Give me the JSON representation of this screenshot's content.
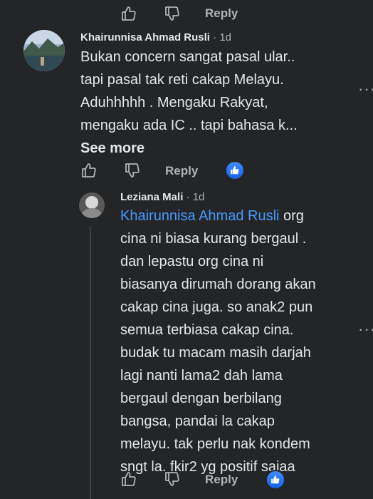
{
  "top_actions": {
    "reply_label": "Reply"
  },
  "comment1": {
    "author": "Khairunnisa Ahmad Rusli",
    "time": "1d",
    "lines": [
      "Bukan concern sangat pasal ular..",
      "tapi pasal tak reti cakap Melayu.",
      "Aduhhhhh . Mengaku Rakyat,",
      "mengaku ada IC .. tapi bahasa k..."
    ],
    "see_more": "See more",
    "reply_label": "Reply",
    "reaction_icon": "like-reaction-icon"
  },
  "reply1": {
    "author": "Leziana Mali",
    "time": "1d",
    "mention": "Khairunnisa Ahmad Rusli",
    "first_line_rest": " org",
    "lines": [
      "cina ni biasa kurang bergaul .",
      "dan lepastu org cina ni",
      "biasanya dirumah dorang akan",
      "cakap cina juga. so anak2 pun",
      "semua terbiasa cakap cina.",
      "budak tu macam masih darjah",
      "lagi nanti lama2 dah lama",
      "bergaul dengan berbilang",
      "bangsa, pandai la cakap",
      "melayu. tak perlu nak kondem",
      "sngt la. fkir2 yg positif sajaa"
    ],
    "reply_label": "Reply",
    "reaction_icon": "like-reaction-icon"
  },
  "colors": {
    "background": "#242526",
    "text": "#e4e6eb",
    "secondary": "#b0b3b8",
    "mention": "#4599ff",
    "like_blue": "#1877f2"
  }
}
